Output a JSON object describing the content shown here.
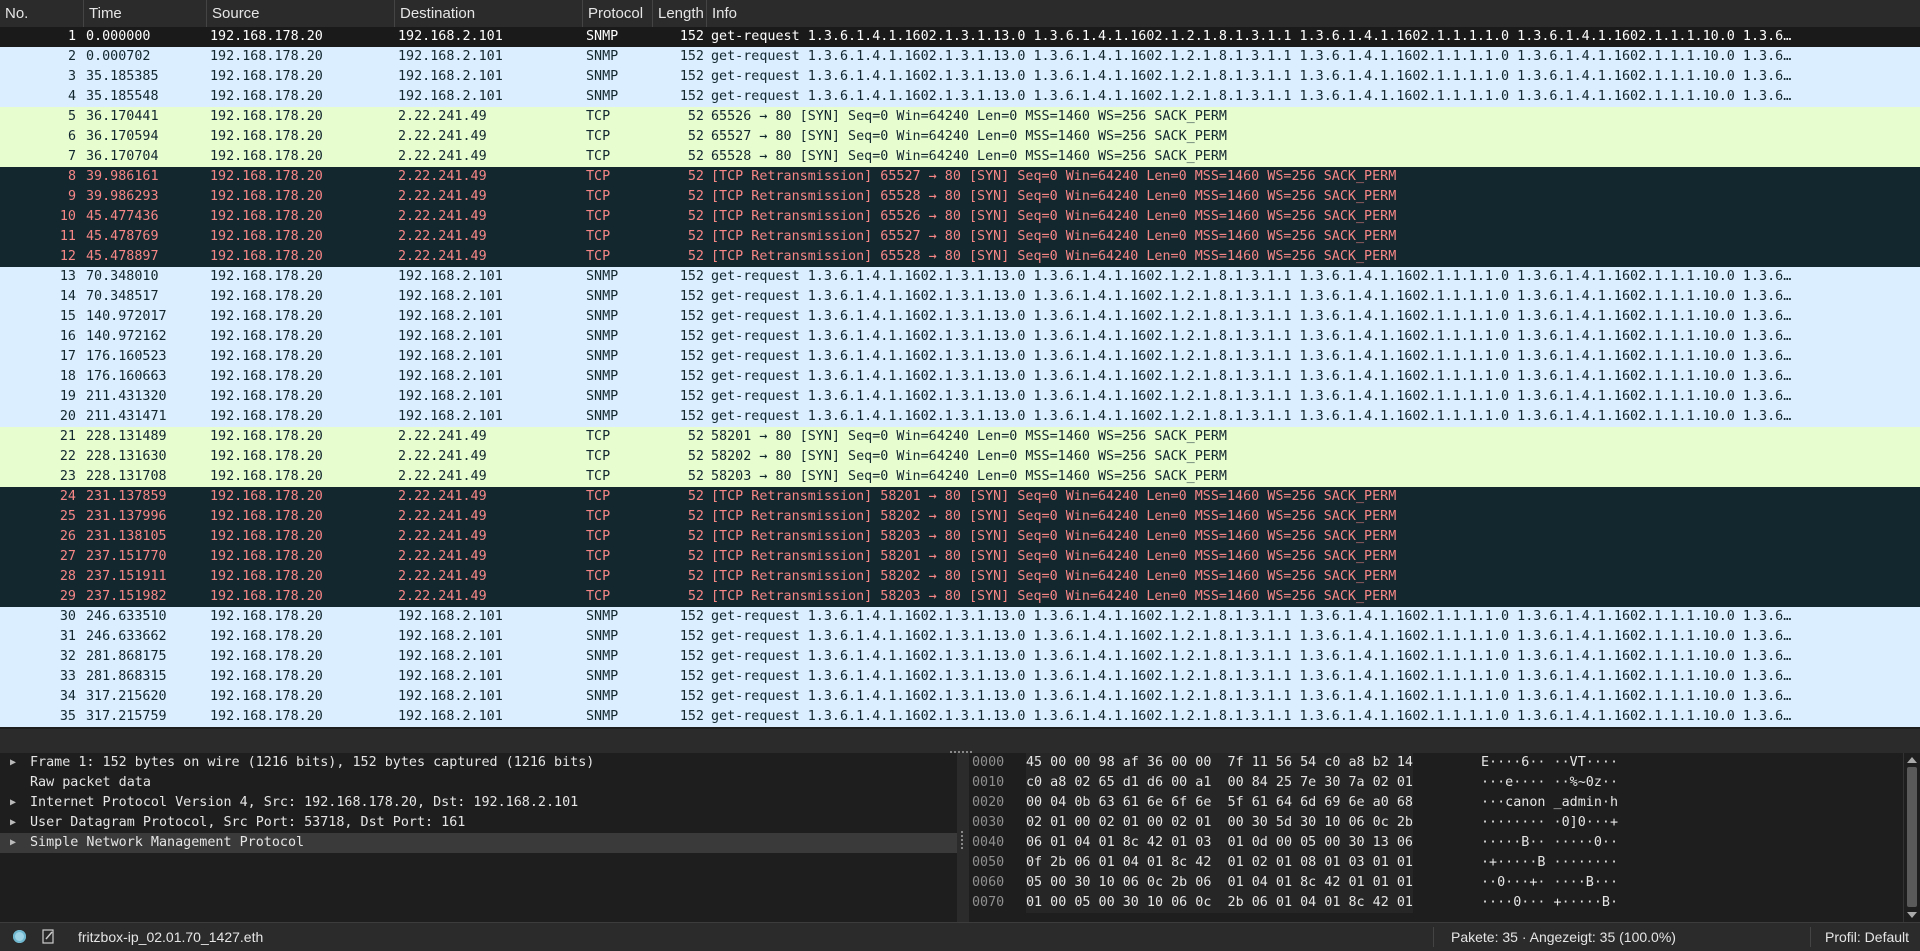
{
  "columns": [
    "No.",
    "Time",
    "Source",
    "Destination",
    "Protocol",
    "Length",
    "Info"
  ],
  "colors": {
    "snmp": "#daeeff",
    "tcp": "#e7fdd0",
    "retransmission_bg": "#12272e",
    "retransmission_fg": "#f78787",
    "selected": "#1a1a1a"
  },
  "packets": [
    {
      "no": "1",
      "time": "0.000000",
      "src": "192.168.178.20",
      "dst": "192.168.2.101",
      "proto": "SNMP",
      "len": "152",
      "info": "get-request 1.3.6.1.4.1.1602.1.3.1.13.0 1.3.6.1.4.1.1602.1.2.1.8.1.3.1.1 1.3.6.1.4.1.1602.1.1.1.1.0 1.3.6.1.4.1.1602.1.1.1.10.0 1.3.6…",
      "kind": "selected"
    },
    {
      "no": "2",
      "time": "0.000702",
      "src": "192.168.178.20",
      "dst": "192.168.2.101",
      "proto": "SNMP",
      "len": "152",
      "info": "get-request 1.3.6.1.4.1.1602.1.3.1.13.0 1.3.6.1.4.1.1602.1.2.1.8.1.3.1.1 1.3.6.1.4.1.1602.1.1.1.1.0 1.3.6.1.4.1.1602.1.1.1.10.0 1.3.6…",
      "kind": "snmp"
    },
    {
      "no": "3",
      "time": "35.185385",
      "src": "192.168.178.20",
      "dst": "192.168.2.101",
      "proto": "SNMP",
      "len": "152",
      "info": "get-request 1.3.6.1.4.1.1602.1.3.1.13.0 1.3.6.1.4.1.1602.1.2.1.8.1.3.1.1 1.3.6.1.4.1.1602.1.1.1.1.0 1.3.6.1.4.1.1602.1.1.1.10.0 1.3.6…",
      "kind": "snmp"
    },
    {
      "no": "4",
      "time": "35.185548",
      "src": "192.168.178.20",
      "dst": "192.168.2.101",
      "proto": "SNMP",
      "len": "152",
      "info": "get-request 1.3.6.1.4.1.1602.1.3.1.13.0 1.3.6.1.4.1.1602.1.2.1.8.1.3.1.1 1.3.6.1.4.1.1602.1.1.1.1.0 1.3.6.1.4.1.1602.1.1.1.10.0 1.3.6…",
      "kind": "snmp"
    },
    {
      "no": "5",
      "time": "36.170441",
      "src": "192.168.178.20",
      "dst": "2.22.241.49",
      "proto": "TCP",
      "len": "52",
      "info": "65526 → 80 [SYN] Seq=0 Win=64240 Len=0 MSS=1460 WS=256 SACK_PERM",
      "kind": "tcp"
    },
    {
      "no": "6",
      "time": "36.170594",
      "src": "192.168.178.20",
      "dst": "2.22.241.49",
      "proto": "TCP",
      "len": "52",
      "info": "65527 → 80 [SYN] Seq=0 Win=64240 Len=0 MSS=1460 WS=256 SACK_PERM",
      "kind": "tcp"
    },
    {
      "no": "7",
      "time": "36.170704",
      "src": "192.168.178.20",
      "dst": "2.22.241.49",
      "proto": "TCP",
      "len": "52",
      "info": "65528 → 80 [SYN] Seq=0 Win=64240 Len=0 MSS=1460 WS=256 SACK_PERM",
      "kind": "tcp"
    },
    {
      "no": "8",
      "time": "39.986161",
      "src": "192.168.178.20",
      "dst": "2.22.241.49",
      "proto": "TCP",
      "len": "52",
      "info": "[TCP Retransmission] 65527 → 80 [SYN] Seq=0 Win=64240 Len=0 MSS=1460 WS=256 SACK_PERM",
      "kind": "retrans"
    },
    {
      "no": "9",
      "time": "39.986293",
      "src": "192.168.178.20",
      "dst": "2.22.241.49",
      "proto": "TCP",
      "len": "52",
      "info": "[TCP Retransmission] 65528 → 80 [SYN] Seq=0 Win=64240 Len=0 MSS=1460 WS=256 SACK_PERM",
      "kind": "retrans"
    },
    {
      "no": "10",
      "time": "45.477436",
      "src": "192.168.178.20",
      "dst": "2.22.241.49",
      "proto": "TCP",
      "len": "52",
      "info": "[TCP Retransmission] 65526 → 80 [SYN] Seq=0 Win=64240 Len=0 MSS=1460 WS=256 SACK_PERM",
      "kind": "retrans"
    },
    {
      "no": "11",
      "time": "45.478769",
      "src": "192.168.178.20",
      "dst": "2.22.241.49",
      "proto": "TCP",
      "len": "52",
      "info": "[TCP Retransmission] 65527 → 80 [SYN] Seq=0 Win=64240 Len=0 MSS=1460 WS=256 SACK_PERM",
      "kind": "retrans"
    },
    {
      "no": "12",
      "time": "45.478897",
      "src": "192.168.178.20",
      "dst": "2.22.241.49",
      "proto": "TCP",
      "len": "52",
      "info": "[TCP Retransmission] 65528 → 80 [SYN] Seq=0 Win=64240 Len=0 MSS=1460 WS=256 SACK_PERM",
      "kind": "retrans"
    },
    {
      "no": "13",
      "time": "70.348010",
      "src": "192.168.178.20",
      "dst": "192.168.2.101",
      "proto": "SNMP",
      "len": "152",
      "info": "get-request 1.3.6.1.4.1.1602.1.3.1.13.0 1.3.6.1.4.1.1602.1.2.1.8.1.3.1.1 1.3.6.1.4.1.1602.1.1.1.1.0 1.3.6.1.4.1.1602.1.1.1.10.0 1.3.6…",
      "kind": "snmp"
    },
    {
      "no": "14",
      "time": "70.348517",
      "src": "192.168.178.20",
      "dst": "192.168.2.101",
      "proto": "SNMP",
      "len": "152",
      "info": "get-request 1.3.6.1.4.1.1602.1.3.1.13.0 1.3.6.1.4.1.1602.1.2.1.8.1.3.1.1 1.3.6.1.4.1.1602.1.1.1.1.0 1.3.6.1.4.1.1602.1.1.1.10.0 1.3.6…",
      "kind": "snmp"
    },
    {
      "no": "15",
      "time": "140.972017",
      "src": "192.168.178.20",
      "dst": "192.168.2.101",
      "proto": "SNMP",
      "len": "152",
      "info": "get-request 1.3.6.1.4.1.1602.1.3.1.13.0 1.3.6.1.4.1.1602.1.2.1.8.1.3.1.1 1.3.6.1.4.1.1602.1.1.1.1.0 1.3.6.1.4.1.1602.1.1.1.10.0 1.3.6…",
      "kind": "snmp"
    },
    {
      "no": "16",
      "time": "140.972162",
      "src": "192.168.178.20",
      "dst": "192.168.2.101",
      "proto": "SNMP",
      "len": "152",
      "info": "get-request 1.3.6.1.4.1.1602.1.3.1.13.0 1.3.6.1.4.1.1602.1.2.1.8.1.3.1.1 1.3.6.1.4.1.1602.1.1.1.1.0 1.3.6.1.4.1.1602.1.1.1.10.0 1.3.6…",
      "kind": "snmp"
    },
    {
      "no": "17",
      "time": "176.160523",
      "src": "192.168.178.20",
      "dst": "192.168.2.101",
      "proto": "SNMP",
      "len": "152",
      "info": "get-request 1.3.6.1.4.1.1602.1.3.1.13.0 1.3.6.1.4.1.1602.1.2.1.8.1.3.1.1 1.3.6.1.4.1.1602.1.1.1.1.0 1.3.6.1.4.1.1602.1.1.1.10.0 1.3.6…",
      "kind": "snmp"
    },
    {
      "no": "18",
      "time": "176.160663",
      "src": "192.168.178.20",
      "dst": "192.168.2.101",
      "proto": "SNMP",
      "len": "152",
      "info": "get-request 1.3.6.1.4.1.1602.1.3.1.13.0 1.3.6.1.4.1.1602.1.2.1.8.1.3.1.1 1.3.6.1.4.1.1602.1.1.1.1.0 1.3.6.1.4.1.1602.1.1.1.10.0 1.3.6…",
      "kind": "snmp"
    },
    {
      "no": "19",
      "time": "211.431320",
      "src": "192.168.178.20",
      "dst": "192.168.2.101",
      "proto": "SNMP",
      "len": "152",
      "info": "get-request 1.3.6.1.4.1.1602.1.3.1.13.0 1.3.6.1.4.1.1602.1.2.1.8.1.3.1.1 1.3.6.1.4.1.1602.1.1.1.1.0 1.3.6.1.4.1.1602.1.1.1.10.0 1.3.6…",
      "kind": "snmp"
    },
    {
      "no": "20",
      "time": "211.431471",
      "src": "192.168.178.20",
      "dst": "192.168.2.101",
      "proto": "SNMP",
      "len": "152",
      "info": "get-request 1.3.6.1.4.1.1602.1.3.1.13.0 1.3.6.1.4.1.1602.1.2.1.8.1.3.1.1 1.3.6.1.4.1.1602.1.1.1.1.0 1.3.6.1.4.1.1602.1.1.1.10.0 1.3.6…",
      "kind": "snmp"
    },
    {
      "no": "21",
      "time": "228.131489",
      "src": "192.168.178.20",
      "dst": "2.22.241.49",
      "proto": "TCP",
      "len": "52",
      "info": "58201 → 80 [SYN] Seq=0 Win=64240 Len=0 MSS=1460 WS=256 SACK_PERM",
      "kind": "tcp"
    },
    {
      "no": "22",
      "time": "228.131630",
      "src": "192.168.178.20",
      "dst": "2.22.241.49",
      "proto": "TCP",
      "len": "52",
      "info": "58202 → 80 [SYN] Seq=0 Win=64240 Len=0 MSS=1460 WS=256 SACK_PERM",
      "kind": "tcp"
    },
    {
      "no": "23",
      "time": "228.131708",
      "src": "192.168.178.20",
      "dst": "2.22.241.49",
      "proto": "TCP",
      "len": "52",
      "info": "58203 → 80 [SYN] Seq=0 Win=64240 Len=0 MSS=1460 WS=256 SACK_PERM",
      "kind": "tcp"
    },
    {
      "no": "24",
      "time": "231.137859",
      "src": "192.168.178.20",
      "dst": "2.22.241.49",
      "proto": "TCP",
      "len": "52",
      "info": "[TCP Retransmission] 58201 → 80 [SYN] Seq=0 Win=64240 Len=0 MSS=1460 WS=256 SACK_PERM",
      "kind": "retrans"
    },
    {
      "no": "25",
      "time": "231.137996",
      "src": "192.168.178.20",
      "dst": "2.22.241.49",
      "proto": "TCP",
      "len": "52",
      "info": "[TCP Retransmission] 58202 → 80 [SYN] Seq=0 Win=64240 Len=0 MSS=1460 WS=256 SACK_PERM",
      "kind": "retrans"
    },
    {
      "no": "26",
      "time": "231.138105",
      "src": "192.168.178.20",
      "dst": "2.22.241.49",
      "proto": "TCP",
      "len": "52",
      "info": "[TCP Retransmission] 58203 → 80 [SYN] Seq=0 Win=64240 Len=0 MSS=1460 WS=256 SACK_PERM",
      "kind": "retrans"
    },
    {
      "no": "27",
      "time": "237.151770",
      "src": "192.168.178.20",
      "dst": "2.22.241.49",
      "proto": "TCP",
      "len": "52",
      "info": "[TCP Retransmission] 58201 → 80 [SYN] Seq=0 Win=64240 Len=0 MSS=1460 WS=256 SACK_PERM",
      "kind": "retrans"
    },
    {
      "no": "28",
      "time": "237.151911",
      "src": "192.168.178.20",
      "dst": "2.22.241.49",
      "proto": "TCP",
      "len": "52",
      "info": "[TCP Retransmission] 58202 → 80 [SYN] Seq=0 Win=64240 Len=0 MSS=1460 WS=256 SACK_PERM",
      "kind": "retrans"
    },
    {
      "no": "29",
      "time": "237.151982",
      "src": "192.168.178.20",
      "dst": "2.22.241.49",
      "proto": "TCP",
      "len": "52",
      "info": "[TCP Retransmission] 58203 → 80 [SYN] Seq=0 Win=64240 Len=0 MSS=1460 WS=256 SACK_PERM",
      "kind": "retrans"
    },
    {
      "no": "30",
      "time": "246.633510",
      "src": "192.168.178.20",
      "dst": "192.168.2.101",
      "proto": "SNMP",
      "len": "152",
      "info": "get-request 1.3.6.1.4.1.1602.1.3.1.13.0 1.3.6.1.4.1.1602.1.2.1.8.1.3.1.1 1.3.6.1.4.1.1602.1.1.1.1.0 1.3.6.1.4.1.1602.1.1.1.10.0 1.3.6…",
      "kind": "snmp"
    },
    {
      "no": "31",
      "time": "246.633662",
      "src": "192.168.178.20",
      "dst": "192.168.2.101",
      "proto": "SNMP",
      "len": "152",
      "info": "get-request 1.3.6.1.4.1.1602.1.3.1.13.0 1.3.6.1.4.1.1602.1.2.1.8.1.3.1.1 1.3.6.1.4.1.1602.1.1.1.1.0 1.3.6.1.4.1.1602.1.1.1.10.0 1.3.6…",
      "kind": "snmp"
    },
    {
      "no": "32",
      "time": "281.868175",
      "src": "192.168.178.20",
      "dst": "192.168.2.101",
      "proto": "SNMP",
      "len": "152",
      "info": "get-request 1.3.6.1.4.1.1602.1.3.1.13.0 1.3.6.1.4.1.1602.1.2.1.8.1.3.1.1 1.3.6.1.4.1.1602.1.1.1.1.0 1.3.6.1.4.1.1602.1.1.1.10.0 1.3.6…",
      "kind": "snmp"
    },
    {
      "no": "33",
      "time": "281.868315",
      "src": "192.168.178.20",
      "dst": "192.168.2.101",
      "proto": "SNMP",
      "len": "152",
      "info": "get-request 1.3.6.1.4.1.1602.1.3.1.13.0 1.3.6.1.4.1.1602.1.2.1.8.1.3.1.1 1.3.6.1.4.1.1602.1.1.1.1.0 1.3.6.1.4.1.1602.1.1.1.10.0 1.3.6…",
      "kind": "snmp"
    },
    {
      "no": "34",
      "time": "317.215620",
      "src": "192.168.178.20",
      "dst": "192.168.2.101",
      "proto": "SNMP",
      "len": "152",
      "info": "get-request 1.3.6.1.4.1.1602.1.3.1.13.0 1.3.6.1.4.1.1602.1.2.1.8.1.3.1.1 1.3.6.1.4.1.1602.1.1.1.1.0 1.3.6.1.4.1.1602.1.1.1.10.0 1.3.6…",
      "kind": "snmp"
    },
    {
      "no": "35",
      "time": "317.215759",
      "src": "192.168.178.20",
      "dst": "192.168.2.101",
      "proto": "SNMP",
      "len": "152",
      "info": "get-request 1.3.6.1.4.1.1602.1.3.1.13.0 1.3.6.1.4.1.1602.1.2.1.8.1.3.1.1 1.3.6.1.4.1.1602.1.1.1.1.0 1.3.6.1.4.1.1602.1.1.1.10.0 1.3.6…",
      "kind": "snmp"
    }
  ],
  "detail": [
    {
      "label": "Frame 1: 152 bytes on wire (1216 bits), 152 bytes captured (1216 bits)",
      "expandable": true,
      "selected": false
    },
    {
      "label": "Raw packet data",
      "expandable": false,
      "selected": false
    },
    {
      "label": "Internet Protocol Version 4, Src: 192.168.178.20, Dst: 192.168.2.101",
      "expandable": true,
      "selected": false
    },
    {
      "label": "User Datagram Protocol, Src Port: 53718, Dst Port: 161",
      "expandable": true,
      "selected": false
    },
    {
      "label": "Simple Network Management Protocol",
      "expandable": true,
      "selected": true
    }
  ],
  "hex": [
    {
      "offset": "0000",
      "bytes": "45 00 00 98 af 36 00 00  7f 11 56 54 c0 a8 b2 14",
      "ascii": "E····6·· ··VT····"
    },
    {
      "offset": "0010",
      "bytes": "c0 a8 02 65 d1 d6 00 a1  00 84 25 7e 30 7a 02 01",
      "ascii": "···e···· ··%~0z··"
    },
    {
      "offset": "0020",
      "bytes": "00 04 0b 63 61 6e 6f 6e  5f 61 64 6d 69 6e a0 68",
      "ascii": "···canon _admin·h"
    },
    {
      "offset": "0030",
      "bytes": "02 01 00 02 01 00 02 01  00 30 5d 30 10 06 0c 2b",
      "ascii": "········ ·0]0···+"
    },
    {
      "offset": "0040",
      "bytes": "06 01 04 01 8c 42 01 03  01 0d 00 05 00 30 13 06",
      "ascii": "·····B·· ·····0··"
    },
    {
      "offset": "0050",
      "bytes": "0f 2b 06 01 04 01 8c 42  01 02 01 08 01 03 01 01",
      "ascii": "·+·····B ········"
    },
    {
      "offset": "0060",
      "bytes": "05 00 30 10 06 0c 2b 06  01 04 01 8c 42 01 01 01",
      "ascii": "··0···+· ····B···"
    },
    {
      "offset": "0070",
      "bytes": "01 00 05 00 30 10 06 0c  2b 06 01 04 01 8c 42 01",
      "ascii": "····0··· +·····B·"
    }
  ],
  "status": {
    "filename": "fritzbox-ip_02.01.70_1427.eth",
    "packets": "Pakete: 35 · Angezeigt: 35 (100.0%)",
    "profile": "Profil: Default"
  }
}
